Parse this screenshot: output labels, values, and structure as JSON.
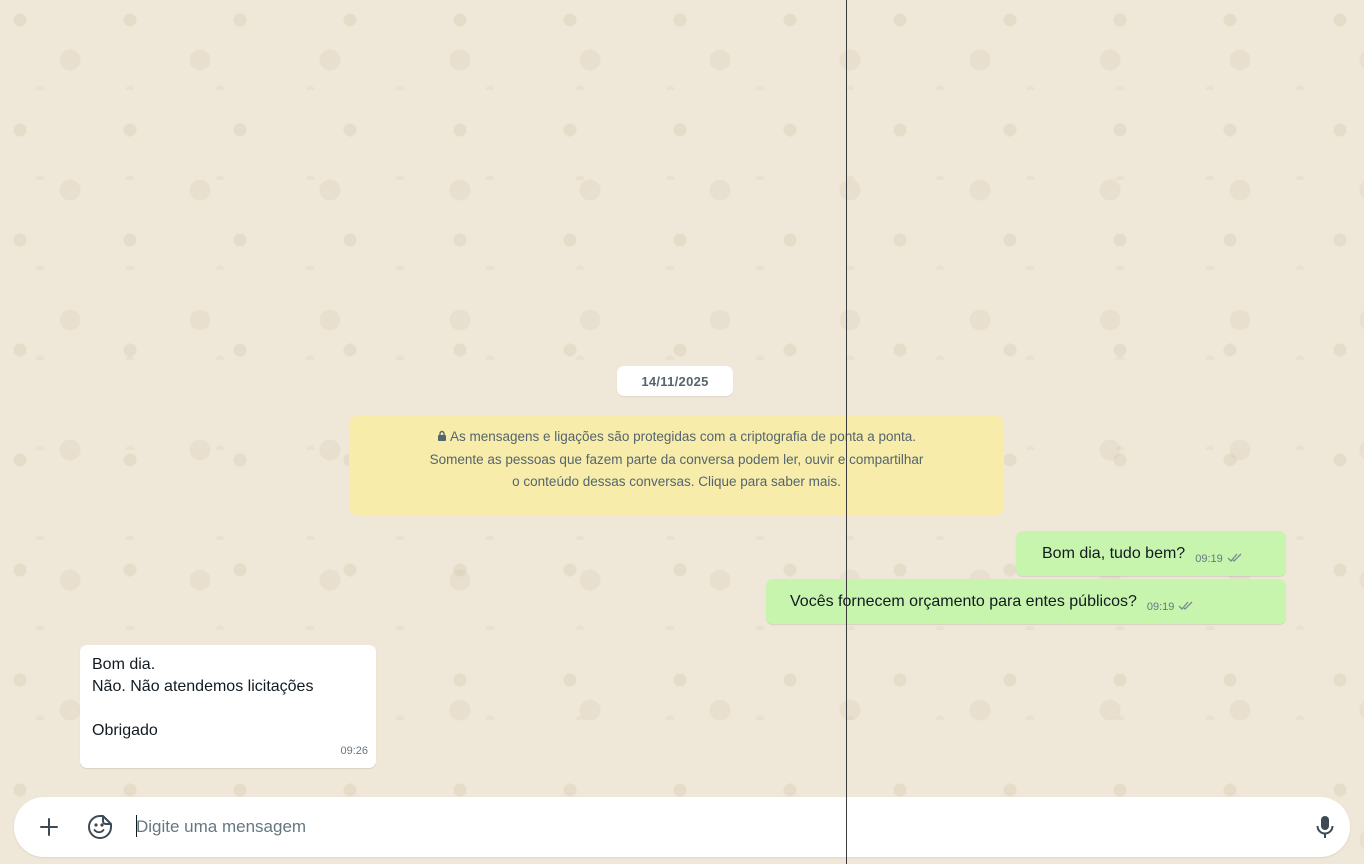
{
  "conversation": {
    "date_label": "14/11/2025",
    "encryption_notice": {
      "icon": "lock-icon",
      "lines": [
        "As mensagens e ligações são protegidas com a criptografia de ponta a ponta.",
        "Somente as pessoas que fazem parte da conversa podem ler, ouvir e compartilhar",
        "o conteúdo dessas conversas. Clique para saber mais."
      ]
    },
    "messages": [
      {
        "direction": "outgoing",
        "text": "Bom dia, tudo bem?",
        "time": "09:19",
        "status": "read-double-check"
      },
      {
        "direction": "outgoing",
        "text": "Vocês fornecem orçamento para entes públicos?",
        "time": "09:19",
        "status": "read-double-check"
      },
      {
        "direction": "incoming",
        "lines": [
          "Bom dia.",
          "Não. Não atendemos licitações",
          "",
          "Obrigado"
        ],
        "time": "09:26"
      }
    ]
  },
  "composer": {
    "placeholder": "Digite uma mensagem",
    "value": "",
    "icons": {
      "attach": "plus-icon",
      "sticker": "sticker-icon",
      "voice": "microphone-icon"
    }
  },
  "colors": {
    "chat_background": "#efe8d8",
    "outgoing_bubble": "#c7f5ad",
    "incoming_bubble": "#ffffff",
    "notice_background": "#f7ecaa",
    "secondary_text": "#667781"
  }
}
